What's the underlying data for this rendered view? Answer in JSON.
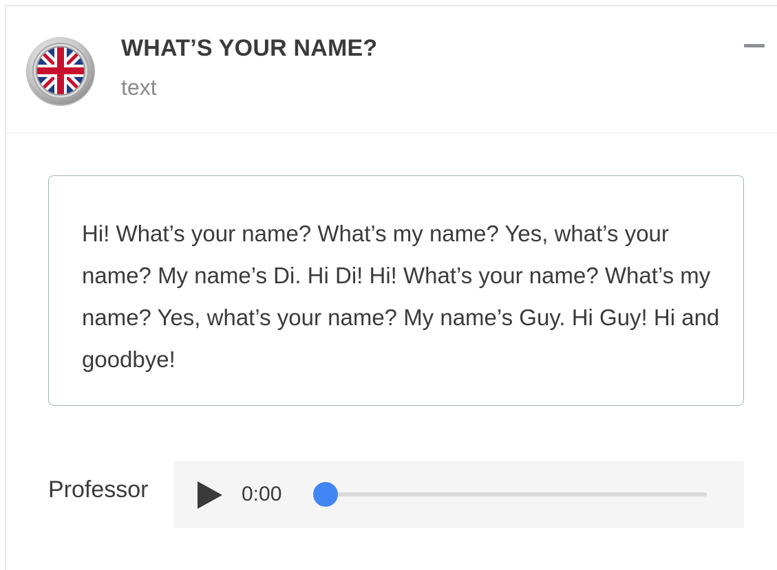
{
  "lesson": {
    "title": "WHAT’S YOUR NAME?",
    "subtitle": "text",
    "flag_icon": "uk-flag-icon",
    "collapse_icon": "minus-icon"
  },
  "passage": {
    "text": "Hi! What’s your name? What’s my name? Yes, what’s your name? My name’s Di. Hi Di! Hi! What’s your name? What’s my name? Yes, what’s your name? My name’s Guy. Hi Guy! Hi and goodbye!"
  },
  "audio": {
    "speaker": "Professor",
    "current_time": "0:00",
    "progress": 0,
    "play_icon": "play-icon",
    "accent_color": "#4285f4"
  }
}
